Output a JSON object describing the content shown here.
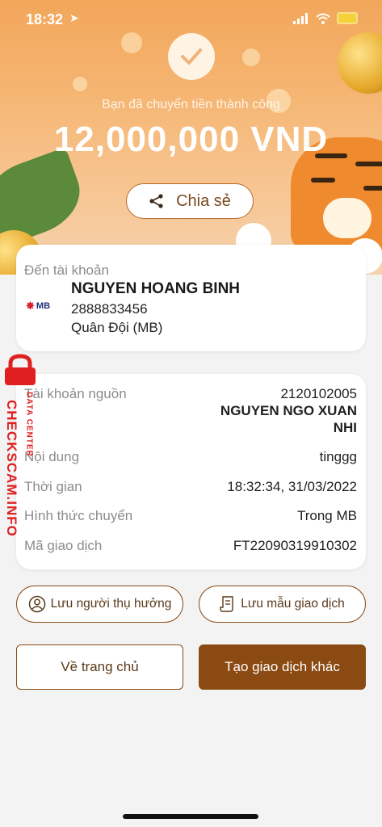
{
  "status_bar": {
    "time": "18:32"
  },
  "hero": {
    "success_message": "Bạn đã chuyển tiền thành công",
    "amount": "12,000,000 VND",
    "share_label": "Chia sẻ"
  },
  "recipient": {
    "section_label": "Đến tài khoản",
    "bank_logo_text": "MB",
    "name": "NGUYEN HOANG BINH",
    "account_number": "2888833456",
    "bank_name": "Quân Đội (MB)"
  },
  "details": {
    "source_account_label": "Tài khoản nguồn",
    "source_account_number": "2120102005",
    "source_account_name_line1": "NGUYEN NGO XUAN",
    "source_account_name_line2": "NHI",
    "content_label": "Nội dung",
    "content_value": "tinggg",
    "time_label": "Thời gian",
    "time_value": "18:32:34, 31/03/2022",
    "method_label": "Hình thức chuyển",
    "method_value": "Trong MB",
    "transaction_id_label": "Mã giao dịch",
    "transaction_id_value": "FT22090319910302"
  },
  "actions": {
    "save_beneficiary_label": "Lưu người thụ hưởng",
    "save_template_label": "Lưu mẫu giao dịch",
    "home_label": "Về trang chủ",
    "new_transaction_label": "Tạo giao dịch khác"
  },
  "watermark": {
    "site": "CHECKSCAM.INFO",
    "sub": "DATA CENTER"
  },
  "colors": {
    "accent_brown": "#8b4a12",
    "hero_orange": "#f2a65a",
    "watermark_red": "#e02020"
  }
}
